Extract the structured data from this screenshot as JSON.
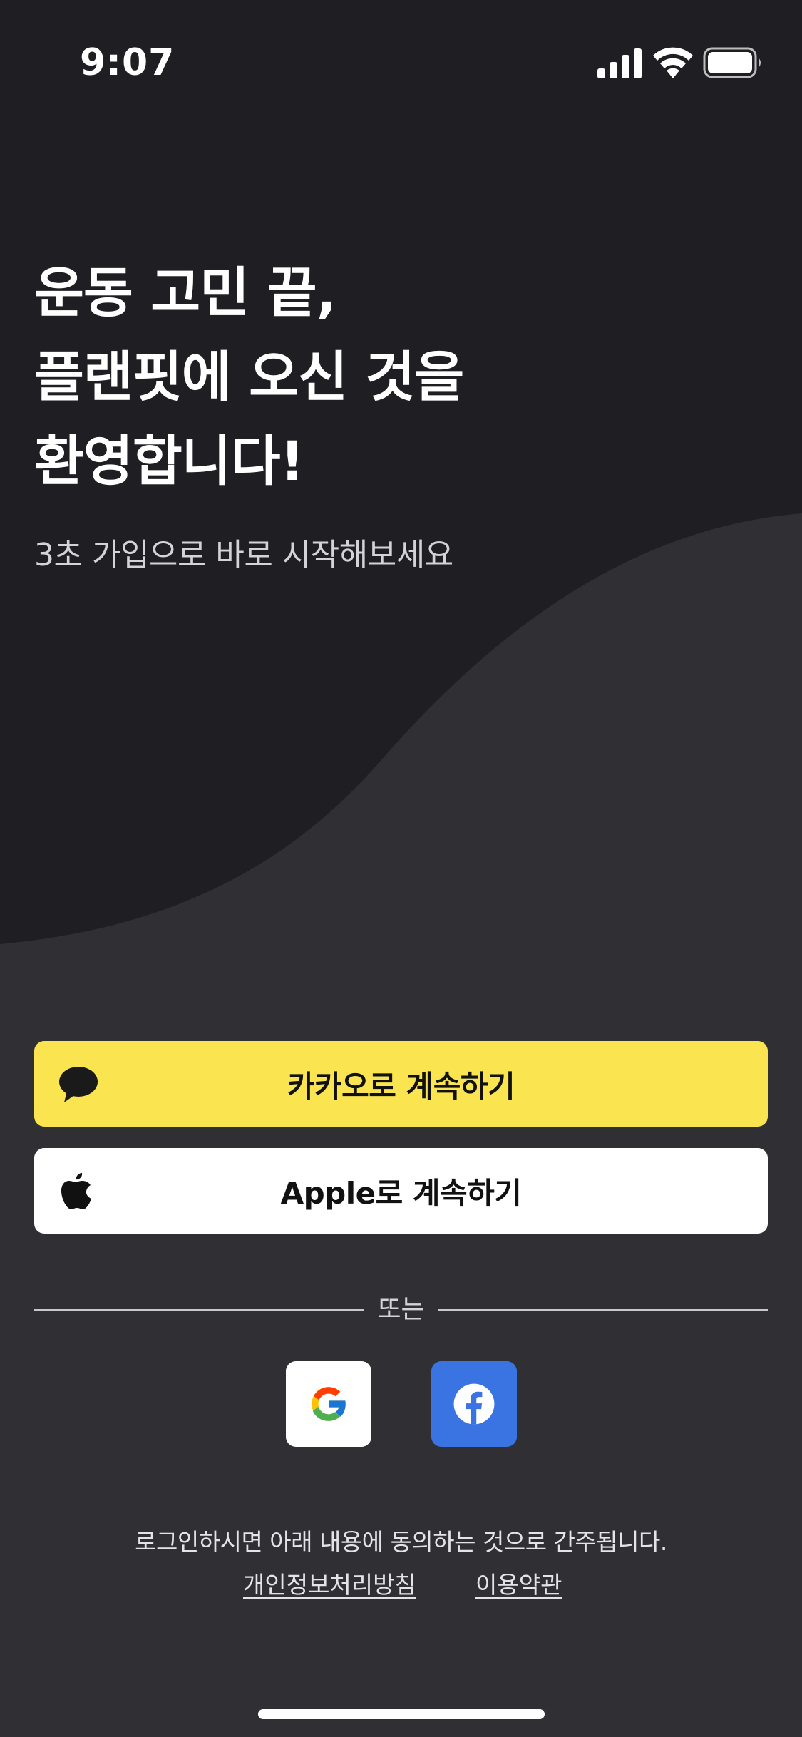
{
  "status_bar": {
    "time": "9:07",
    "signal_icon": "cellular-signal-icon",
    "wifi_icon": "wifi-icon",
    "battery_icon": "battery-full-icon"
  },
  "hero": {
    "headline_lines": [
      "운동 고민 끝,",
      "플랜핏에 오신 것을",
      "환영합니다!"
    ],
    "subtitle": "3초 가입으로 바로 시작해보세요"
  },
  "auth": {
    "kakao_label": "카카오로 계속하기",
    "kakao_icon": "kakao-speech-bubble-icon",
    "apple_label": "Apple로 계속하기",
    "apple_icon": "apple-logo-icon",
    "divider_label": "또는",
    "social": [
      {
        "name": "google",
        "icon": "google-logo-icon"
      },
      {
        "name": "facebook",
        "icon": "facebook-logo-icon"
      }
    ]
  },
  "footer": {
    "consent_text": "로그인하시면 아래 내용에 동의하는 것으로 간주됩니다.",
    "privacy_link": "개인정보처리방침",
    "terms_link": "이용약관"
  },
  "colors": {
    "background_dark": "#1f1f23",
    "background_wave": "#2f2f34",
    "kakao_yellow": "#fae44f",
    "facebook_blue": "#3a74e3"
  }
}
